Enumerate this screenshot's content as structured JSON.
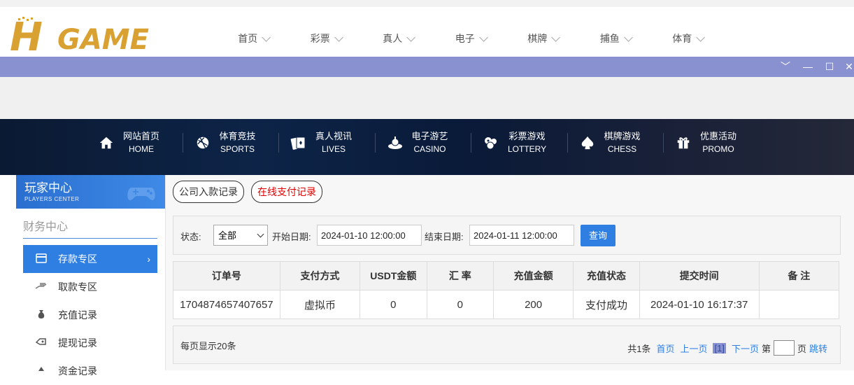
{
  "header": {
    "logo_h": "H",
    "logo_game": "GAME",
    "nav": [
      {
        "label": "首页"
      },
      {
        "label": "彩票"
      },
      {
        "label": "真人"
      },
      {
        "label": "电子"
      },
      {
        "label": "棋牌"
      },
      {
        "label": "捕鱼"
      },
      {
        "label": "体育"
      }
    ]
  },
  "window_controls": {
    "chevron": "﹀",
    "minimize": "—",
    "maximize": "☐",
    "close": "✕"
  },
  "dark_nav": [
    {
      "cn": "网站首页",
      "en": "HOME",
      "icon": "home-icon"
    },
    {
      "cn": "体育竞技",
      "en": "SPORTS",
      "icon": "ball-icon"
    },
    {
      "cn": "真人视讯",
      "en": "LIVES",
      "icon": "cards-icon"
    },
    {
      "cn": "电子游艺",
      "en": "CASINO",
      "icon": "slot-icon"
    },
    {
      "cn": "彩票游戏",
      "en": "LOTTERY",
      "icon": "lottery-icon"
    },
    {
      "cn": "棋牌游戏",
      "en": "CHESS",
      "icon": "spade-icon"
    },
    {
      "cn": "优惠活动",
      "en": "PROMO",
      "icon": "gift-icon"
    }
  ],
  "sidebar": {
    "title": "玩家中心",
    "subtitle": "PLAYERS CENTER",
    "section": "财务中心",
    "items": [
      {
        "label": "存款专区",
        "icon": "deposit-icon",
        "active": true
      },
      {
        "label": "取款专区",
        "icon": "withdraw-icon"
      },
      {
        "label": "充值记录",
        "icon": "moneybag-icon"
      },
      {
        "label": "提现记录",
        "icon": "hand-cash-icon"
      },
      {
        "label": "资金记录",
        "icon": "record-icon"
      }
    ]
  },
  "tabs": [
    {
      "label": "公司入款记录",
      "color": "#333333"
    },
    {
      "label": "在线支付记录",
      "color": "#e00000"
    }
  ],
  "filter": {
    "status_label": "状态:",
    "status_value": "全部",
    "start_label": "开始日期:",
    "start_value": "2024-01-10 12:00:00",
    "end_label": "结束日期:",
    "end_value": "2024-01-11 12:00:00",
    "query_label": "查询"
  },
  "table": {
    "headers": [
      "订单号",
      "支付方式",
      "USDT金额",
      "汇 率",
      "充值金额",
      "充值状态",
      "提交时间",
      "备 注"
    ],
    "rows": [
      [
        "1704874657407657",
        "虚拟币",
        "0",
        "0",
        "200",
        "支付成功",
        "2024-01-10 16:17:37",
        ""
      ]
    ]
  },
  "pager": {
    "per_page": "每页显示20条",
    "total": "共1条",
    "first": "首页",
    "prev": "上一页",
    "current": "[1]",
    "next": "下一页",
    "page_pre": "第",
    "page_post": "页",
    "jump": "跳转"
  },
  "colors": {
    "accent": "#2f7fe2",
    "window_bar": "#8a91d1",
    "logo_gold": "#d9a132"
  }
}
